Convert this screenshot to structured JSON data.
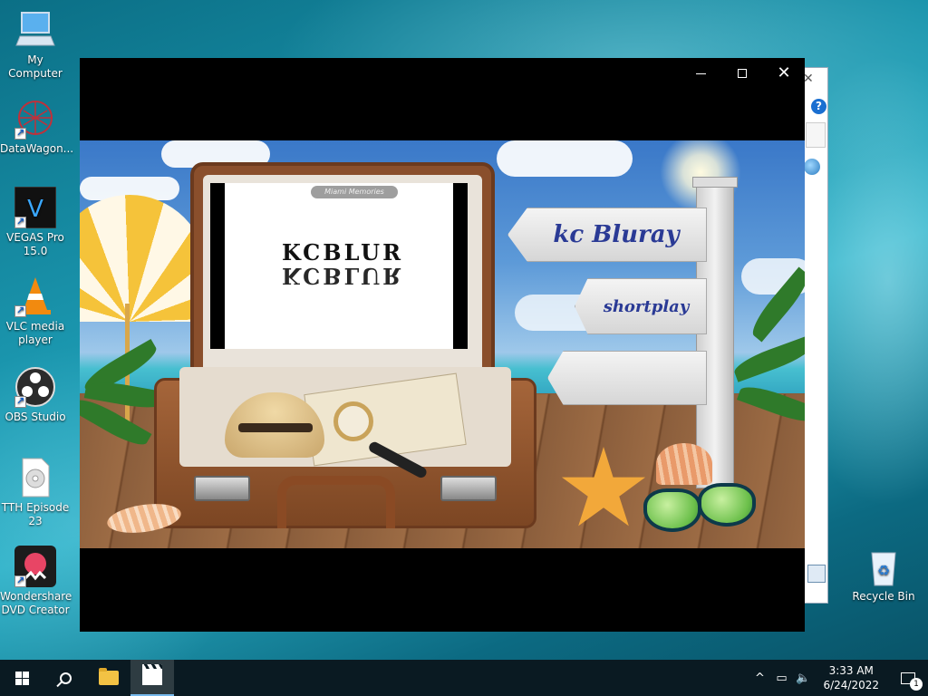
{
  "desktop": {
    "icons": [
      {
        "label": "My Computer",
        "icon": "computer-icon"
      },
      {
        "label": "DataWagon...",
        "icon": "datawagon-icon"
      },
      {
        "label": "VEGAS Pro 15.0",
        "icon": "vegas-pro-icon"
      },
      {
        "label": "VLC media player",
        "icon": "vlc-icon"
      },
      {
        "label": "OBS Studio",
        "icon": "obs-icon"
      },
      {
        "label": "TTH Episode 23",
        "icon": "disc-file-icon"
      },
      {
        "label": "Wondershare DVD Creator",
        "icon": "wondershare-icon"
      },
      {
        "label": "Recycle Bin",
        "icon": "recycle-bin-icon"
      }
    ]
  },
  "window": {
    "controls": {
      "minimize": "minimize-icon",
      "maximize": "maximize-icon",
      "close": "close-icon"
    }
  },
  "menu_scene": {
    "screen_tag": "Miami Memories",
    "screen_logo": "KCBLUR",
    "signs": [
      {
        "label": "kc Bluray"
      },
      {
        "label": "shortplay"
      },
      {
        "label": ""
      }
    ]
  },
  "taskbar": {
    "start": "windows-logo-icon",
    "search": "search-icon",
    "apps": [
      {
        "name": "file-explorer-icon"
      },
      {
        "name": "clapperboard-icon",
        "active": true
      }
    ],
    "tray": {
      "chevron": "^",
      "time": "3:33 AM",
      "date": "6/24/2022",
      "notification_count": "1"
    }
  },
  "colors": {
    "sign_text": "#2a3a95",
    "taskbar_bg": "#0a1a22",
    "accent": "#76b9ed"
  }
}
